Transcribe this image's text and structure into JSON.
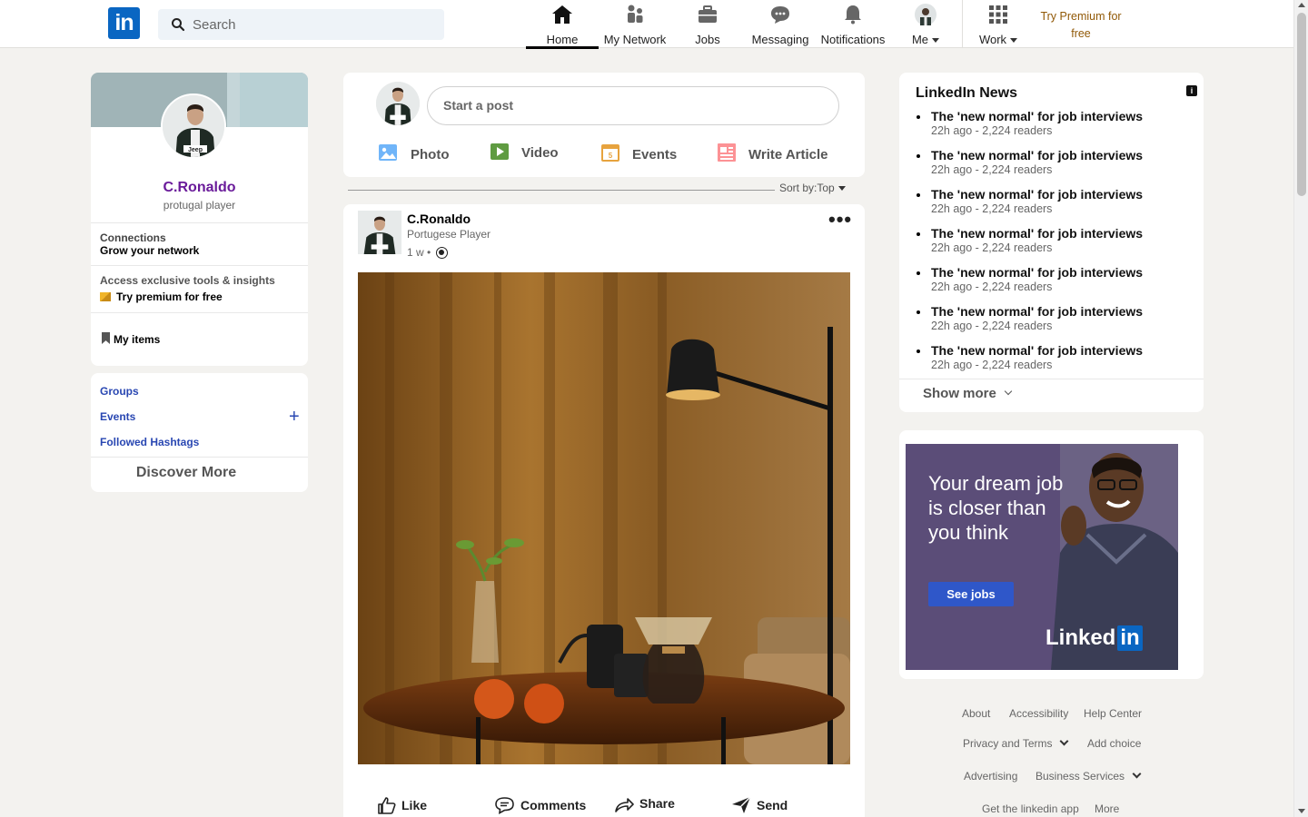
{
  "nav": {
    "logo": "in",
    "search_placeholder": "Search",
    "items": [
      {
        "label": "Home",
        "icon": "home-icon"
      },
      {
        "label": "My Network",
        "icon": "network-icon"
      },
      {
        "label": "Jobs",
        "icon": "briefcase-icon"
      },
      {
        "label": "Messaging",
        "icon": "chat-icon"
      },
      {
        "label": "Notifications",
        "icon": "bell-icon"
      },
      {
        "label": "Me",
        "icon": "avatar"
      },
      {
        "label": "Work",
        "icon": "grid-icon"
      }
    ],
    "premium_line1": "Try Premium for",
    "premium_line2": "free"
  },
  "profile": {
    "name": "C.Ronaldo",
    "subtitle": "protugal player",
    "connections_title": "Connections",
    "connections_sub": "Grow your network",
    "access_title": "Access exclusive tools & insights",
    "access_sub": "Try premium for free",
    "my_items": "My items"
  },
  "groups": {
    "items": [
      "Groups",
      "Events",
      "Followed Hashtags"
    ],
    "discover": "Discover More"
  },
  "postbox": {
    "placeholder": "Start a post",
    "actions": [
      {
        "label": "Photo",
        "color": "#70b5f9"
      },
      {
        "label": "Video",
        "color": "#5f9b41"
      },
      {
        "label": "Events",
        "color": "#e7a33e"
      },
      {
        "label": "Write Article",
        "color": "#fc9295"
      }
    ]
  },
  "sort": {
    "label": "Sort by:",
    "value": "Top"
  },
  "post": {
    "author": "C.Ronaldo",
    "subtitle": "Portugese Player",
    "time": "1 w •",
    "actions": [
      "Like",
      "Comments",
      "Share",
      "Send"
    ]
  },
  "news": {
    "title": "LinkedIn News",
    "info": "i",
    "items": [
      {
        "headline": "The 'new normal' for job interviews",
        "meta": "22h ago - 2,224 readers"
      },
      {
        "headline": "The 'new normal' for job interviews",
        "meta": "22h ago - 2,224 readers"
      },
      {
        "headline": "The 'new normal' for job interviews",
        "meta": "22h ago - 2,224 readers"
      },
      {
        "headline": "The 'new normal' for job interviews",
        "meta": "22h ago - 2,224 readers"
      },
      {
        "headline": "The 'new normal' for job interviews",
        "meta": "22h ago - 2,224 readers"
      },
      {
        "headline": "The 'new normal' for job interviews",
        "meta": "22h ago - 2,224 readers"
      },
      {
        "headline": "The 'new normal' for job interviews",
        "meta": "22h ago - 2,224 readers"
      }
    ],
    "show_more": "Show more"
  },
  "ad": {
    "text": "Your dream job is closer than you think",
    "button": "See jobs",
    "brand": "Linked",
    "brand_in": "in"
  },
  "footer": {
    "about": "About",
    "accessibility": "Accessibility",
    "help": "Help Center",
    "privacy": "Privacy and Terms",
    "ad_choice": "Add choice",
    "advertising": "Advertising",
    "business": "Business Services",
    "get_app": "Get the linkedin app",
    "more": "More"
  }
}
